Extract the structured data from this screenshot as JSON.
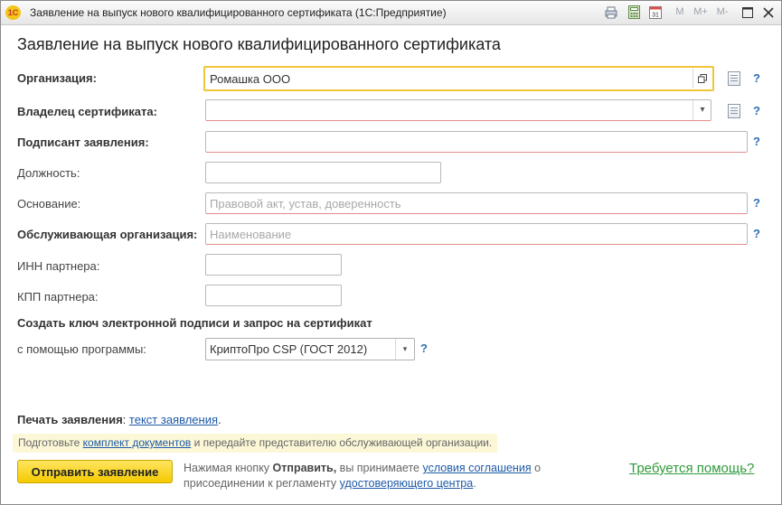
{
  "window": {
    "title": "Заявление на выпуск нового квалифицированного сертификата  (1С:Предприятие)",
    "logo_text": "1С",
    "buttons": [
      "M",
      "M+",
      "M-"
    ]
  },
  "form": {
    "heading": "Заявление на выпуск нового квалифицированного сертификата",
    "organization": {
      "label": "Организация:",
      "value": "Ромашка ООО"
    },
    "owner": {
      "label": "Владелец сертификата:",
      "value": ""
    },
    "signer": {
      "label": "Подписант заявления:",
      "value": ""
    },
    "position": {
      "label": "Должность:",
      "value": ""
    },
    "basis": {
      "label": "Основание:",
      "placeholder": "Правовой акт, устав, доверенность"
    },
    "servicing_org": {
      "label": "Обслуживающая организация:",
      "placeholder": "Наименование"
    },
    "partner_inn": {
      "label": "ИНН партнера:",
      "value": ""
    },
    "partner_kpp": {
      "label": "КПП партнера:",
      "value": ""
    },
    "help_mark": "?",
    "key_section": {
      "title": "Создать ключ электронной подписи и запрос на сертификат",
      "program_label": "с помощью программы:",
      "program_value": "КриптоПро CSP (ГОСТ 2012)"
    }
  },
  "footer": {
    "print_label": "Печать заявления",
    "print_colon": ":",
    "print_link": "текст заявления",
    "print_dot": ".",
    "hint_prefix": "Подготовьте",
    "hint_link": "комплект документов",
    "hint_suffix": "и передайте представителю обслуживающей организации.",
    "send_button": "Отправить заявление",
    "agree_prefix": "Нажимая кнопку",
    "agree_bold": "Отправить,",
    "agree_mid": "вы принимаете",
    "agree_link1": "условия соглашения",
    "agree_o": "о",
    "agree_line2": "присоединении к регламенту",
    "agree_link2": "удостоверяющего центра",
    "agree_dot": ".",
    "help_link": "Требуется помощь?"
  }
}
